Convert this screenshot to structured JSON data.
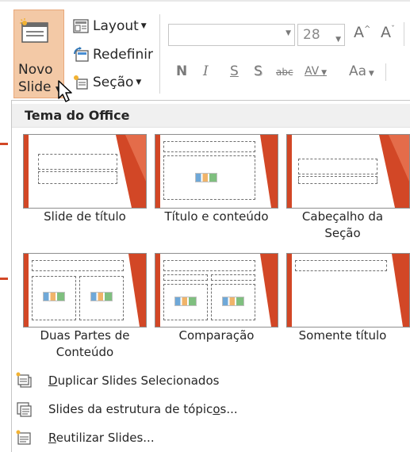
{
  "ribbon": {
    "novo_slide": {
      "line1": "Novo",
      "line2": "Slide"
    },
    "layout_label": "Layout",
    "redefinir_label": "Redefinir",
    "secao_label": "Seção",
    "font_size": "28",
    "format_buttons": [
      "N",
      "I",
      "S",
      "S",
      "abc",
      "AV",
      "Aa"
    ],
    "colors": {
      "accent": "#d24726",
      "novo_bg": "#f3c9a6"
    }
  },
  "gallery": {
    "header": "Tema do Office",
    "layouts": [
      {
        "name": "Slide de título"
      },
      {
        "name": "Título e conteúdo"
      },
      {
        "name": "Cabeçalho da Seção"
      },
      {
        "name": "Duas Partes de Conteúdo"
      },
      {
        "name": "Comparação"
      },
      {
        "name": "Somente título"
      }
    ]
  },
  "menu_items": [
    {
      "label_prefix": "",
      "label_ul": "D",
      "label_rest": "uplicar Slides Selecionados",
      "icon": "duplicate-slides-icon"
    },
    {
      "label_prefix": "Slides da estrutura de tópic",
      "label_ul": "o",
      "label_rest": "s...",
      "icon": "outline-slides-icon"
    },
    {
      "label_prefix": "",
      "label_ul": "R",
      "label_rest": "eutilizar Slides...",
      "icon": "reuse-slides-icon"
    }
  ]
}
